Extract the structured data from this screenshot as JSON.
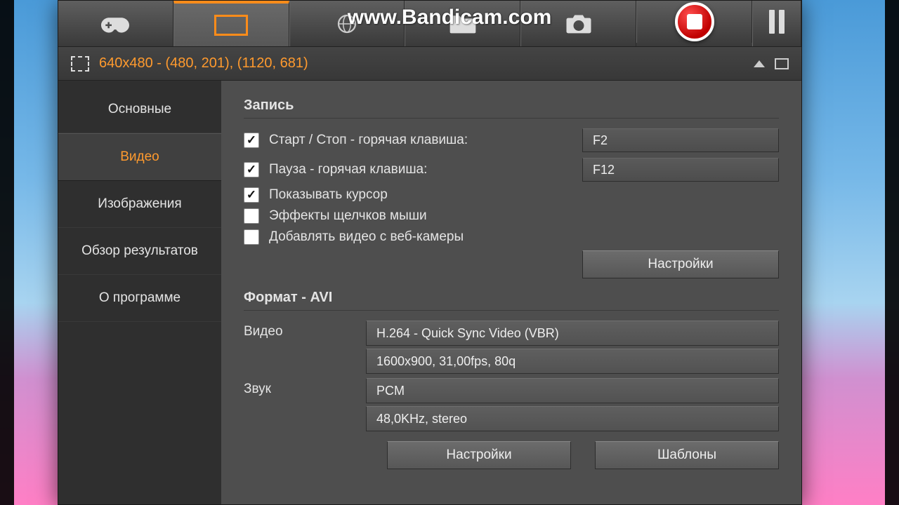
{
  "watermark": "www.Bandicam.com",
  "crop": {
    "text": "640x480 - (480, 201), (1120, 681)"
  },
  "sidebar": {
    "items": [
      {
        "label": "Основные"
      },
      {
        "label": "Видео"
      },
      {
        "label": "Изображения"
      },
      {
        "label": "Обзор результатов"
      },
      {
        "label": "О программе"
      }
    ]
  },
  "record": {
    "title": "Запись",
    "hotkey_startstop_label": "Старт / Стоп - горячая клавиша:",
    "hotkey_startstop_value": "F2",
    "hotkey_pause_label": "Пауза - горячая клавиша:",
    "hotkey_pause_value": "F12",
    "show_cursor_label": "Показывать курсор",
    "click_effects_label": "Эффекты щелчков мыши",
    "webcam_label": "Добавлять видео с веб-камеры",
    "settings_btn": "Настройки"
  },
  "format": {
    "title": "Формат - AVI",
    "video_label": "Видео",
    "video_codec": "H.264 - Quick Sync Video (VBR)",
    "video_params": "1600x900, 31,00fps, 80q",
    "audio_label": "Звук",
    "audio_codec": "PCM",
    "audio_params": "48,0KHz, stereo",
    "settings_btn": "Настройки",
    "presets_btn": "Шаблоны"
  }
}
